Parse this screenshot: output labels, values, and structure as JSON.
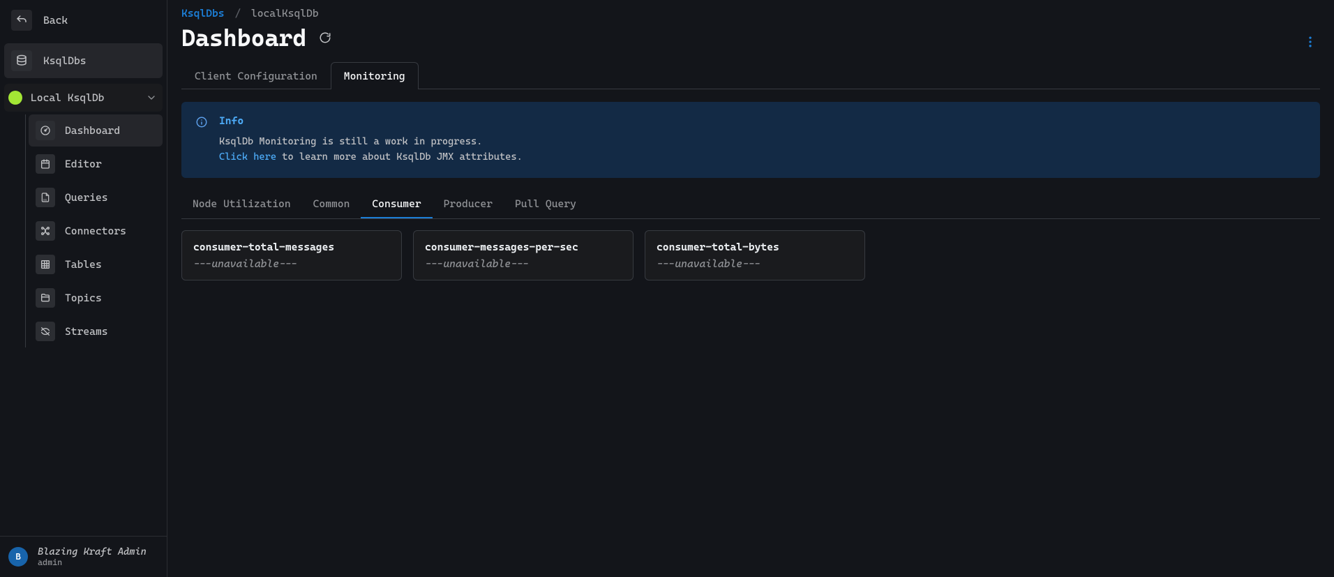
{
  "sidebar": {
    "back_label": "Back",
    "ksqldbs_label": "KsqlDbs",
    "local_label": "Local KsqlDb",
    "items": [
      {
        "label": "Dashboard",
        "icon": "gauge-icon"
      },
      {
        "label": "Editor",
        "icon": "calendar-icon"
      },
      {
        "label": "Queries",
        "icon": "sql-file-icon"
      },
      {
        "label": "Connectors",
        "icon": "connectors-icon"
      },
      {
        "label": "Tables",
        "icon": "table-icon"
      },
      {
        "label": "Topics",
        "icon": "folder-icon"
      },
      {
        "label": "Streams",
        "icon": "stream-icon"
      }
    ]
  },
  "user": {
    "initial": "B",
    "name": "Blazing Kraft Admin",
    "role": "admin"
  },
  "breadcrumb": {
    "link": "KsqlDbs",
    "current": "localKsqlDb"
  },
  "page_title": "Dashboard",
  "top_tabs": [
    {
      "label": "Client Configuration"
    },
    {
      "label": "Monitoring"
    }
  ],
  "info": {
    "title": "Info",
    "text_line1": "KsqlDb Monitoring is still a work in progress.",
    "link_text": "Click here",
    "text_line2_suffix": " to learn more about KsqlDb JMX attributes."
  },
  "sub_tabs": [
    {
      "label": "Node Utilization"
    },
    {
      "label": "Common"
    },
    {
      "label": "Consumer"
    },
    {
      "label": "Producer"
    },
    {
      "label": "Pull Query"
    }
  ],
  "cards": [
    {
      "title": "consumer-total-messages",
      "value": "---unavailable---"
    },
    {
      "title": "consumer-messages-per-sec",
      "value": "---unavailable---"
    },
    {
      "title": "consumer-total-bytes",
      "value": "---unavailable---"
    }
  ]
}
